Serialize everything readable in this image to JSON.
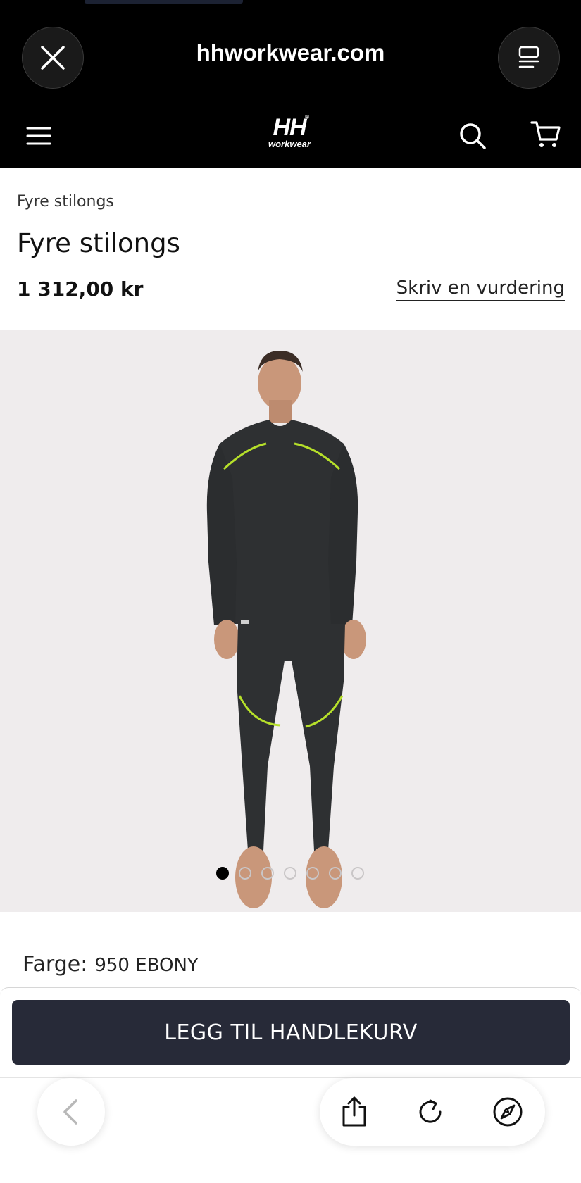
{
  "browser": {
    "url": "hhworkwear.com"
  },
  "site": {
    "logo_main": "HH",
    "logo_sub": "workwear"
  },
  "product": {
    "breadcrumb": "Fyre stilongs",
    "title": "Fyre stilongs",
    "price": "1 312,00 kr",
    "review_link": "Skriv en vurdering",
    "color_label": "Farge:",
    "color_value": "950 EBONY",
    "gallery": {
      "image_count": 7,
      "active_index": 0
    },
    "add_to_cart": "LEGG TIL HANDLEKURV"
  },
  "colors": {
    "header_bg": "#000000",
    "button_bg": "#272a38",
    "image_bg": "#efeced",
    "garment": "#2e3032",
    "accent_stripe": "#b6e02a"
  },
  "icons": [
    "close-icon",
    "tabs-icon",
    "menu-icon",
    "search-icon",
    "cart-icon",
    "back-icon",
    "share-icon",
    "reload-icon",
    "compass-icon"
  ]
}
